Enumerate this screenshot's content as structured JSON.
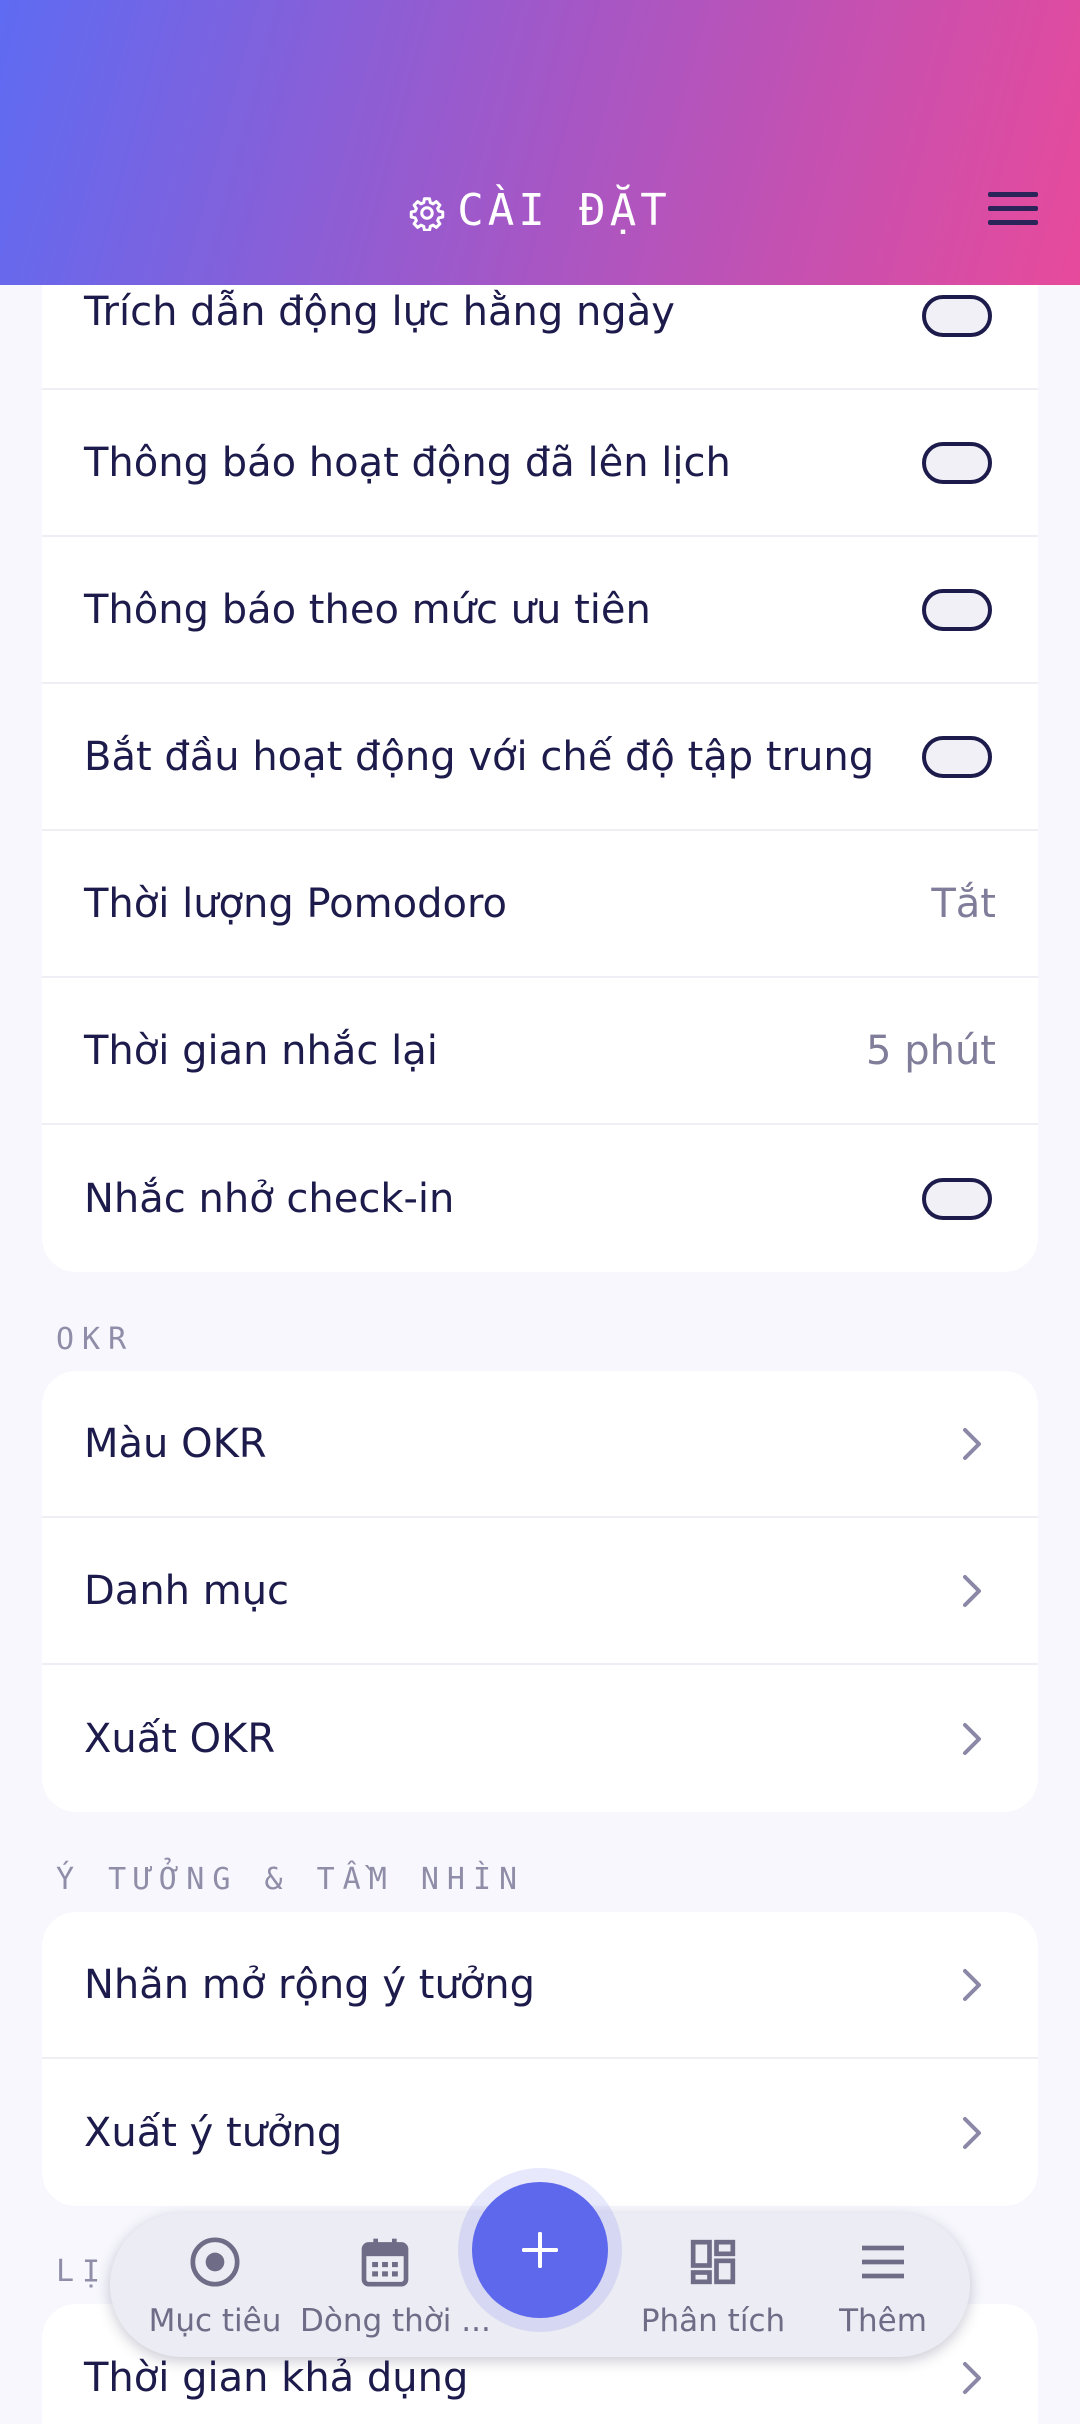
{
  "header": {
    "title": "CÀI ĐẶT",
    "gear_icon": "gear-icon",
    "menu_icon": "hamburger-menu-icon"
  },
  "notifications_card": {
    "rows": [
      {
        "label": "Trích dẫn động lực hằng ngày",
        "control": "toggle",
        "on": false
      },
      {
        "label": "Thông báo hoạt động đã lên lịch",
        "control": "toggle",
        "on": false
      },
      {
        "label": "Thông báo theo mức ưu tiên",
        "control": "toggle",
        "on": false
      },
      {
        "label": "Bắt đầu hoạt động với chế độ tập trung",
        "control": "toggle",
        "on": false
      },
      {
        "label": "Thời lượng Pomodoro",
        "value": "Tắt"
      },
      {
        "label": "Thời gian nhắc lại",
        "value": "5 phút"
      },
      {
        "label": "Nhắc nhở check-in",
        "control": "toggle",
        "on": false
      }
    ]
  },
  "okr_section": {
    "title": "OKR",
    "rows": [
      {
        "label": "Màu OKR"
      },
      {
        "label": "Danh mục"
      },
      {
        "label": "Xuất OKR"
      }
    ]
  },
  "ideas_section": {
    "title": "Ý TƯỞNG & TẦM NHÌN",
    "rows": [
      {
        "label": "Nhãn mở rộng ý tưởng"
      },
      {
        "label": "Xuất ý tưởng"
      }
    ]
  },
  "schedule_section": {
    "title": "LỊ",
    "rows": [
      {
        "label": "Thời gian khả dụng"
      }
    ]
  },
  "bottom_nav": {
    "items": [
      {
        "label": "Mục tiêu",
        "icon": "target-icon"
      },
      {
        "label": "Dòng thời ...",
        "icon": "calendar-icon"
      },
      {
        "label": "Phân tích",
        "icon": "dashboard-icon"
      },
      {
        "label": "Thêm",
        "icon": "menu-icon"
      }
    ],
    "fab_icon": "plus-icon"
  },
  "colors": {
    "accent": "#5d68ec",
    "header_start": "#5e6bf2",
    "header_end": "#e74a9b",
    "text_primary": "#1d1b4b",
    "text_secondary": "#7f7d99"
  }
}
